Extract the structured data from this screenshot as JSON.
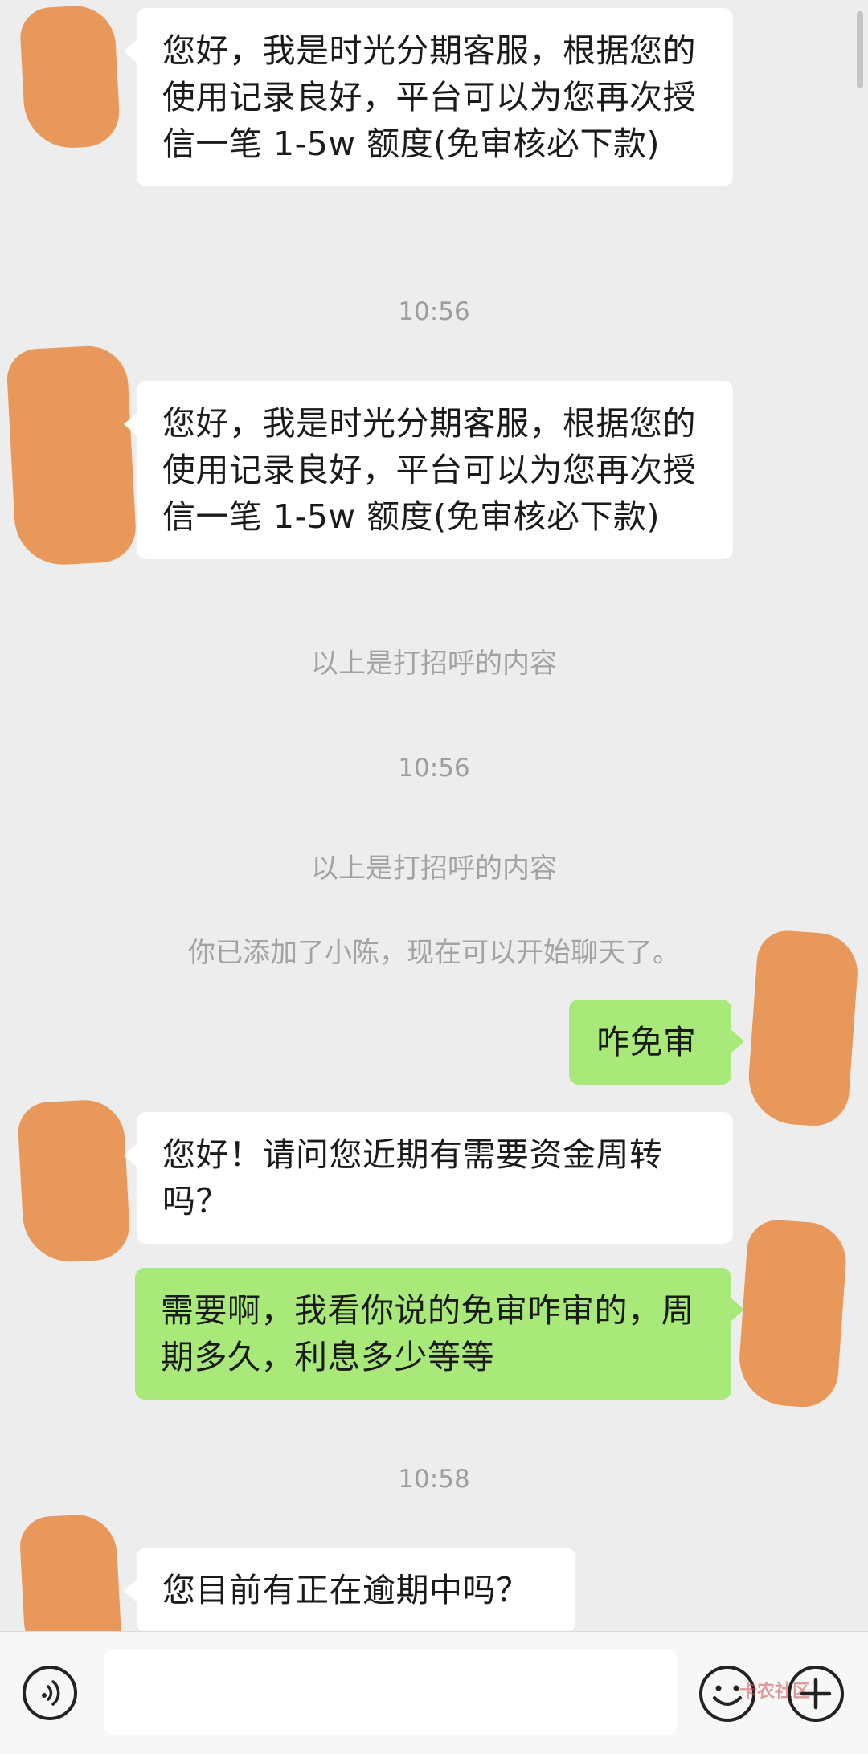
{
  "messages": [
    {
      "text": "您好，我是时光分期客服，根据您的使用记录良好，平台可以为您再次授信一笔 1-5w 额度(免审核必下款)"
    },
    {
      "text": "10:56"
    },
    {
      "text": "您好，我是时光分期客服，根据您的使用记录良好，平台可以为您再次授信一笔 1-5w 额度(免审核必下款)"
    },
    {
      "text": "以上是打招呼的内容"
    },
    {
      "text": "10:56"
    },
    {
      "text": "以上是打招呼的内容"
    },
    {
      "text": "你已添加了小陈，现在可以开始聊天了。"
    },
    {
      "text": "咋免审"
    },
    {
      "text": "您好！请问您近期有需要资金周转吗？"
    },
    {
      "text": "需要啊，我看你说的免审咋审的，周期多久，利息多少等等"
    },
    {
      "text": "10:58"
    },
    {
      "text": "您目前有正在逾期中吗？"
    }
  ],
  "input_bar": {
    "voice_icon": "voice-icon",
    "emoji_icon": "emoji-icon",
    "plus_icon": "plus-icon",
    "watermark_text": "卡农社区"
  },
  "colors": {
    "background": "#ededed",
    "incoming_bubble": "#ffffff",
    "outgoing_bubble": "#a9e97a",
    "redaction": "#e8985a"
  }
}
